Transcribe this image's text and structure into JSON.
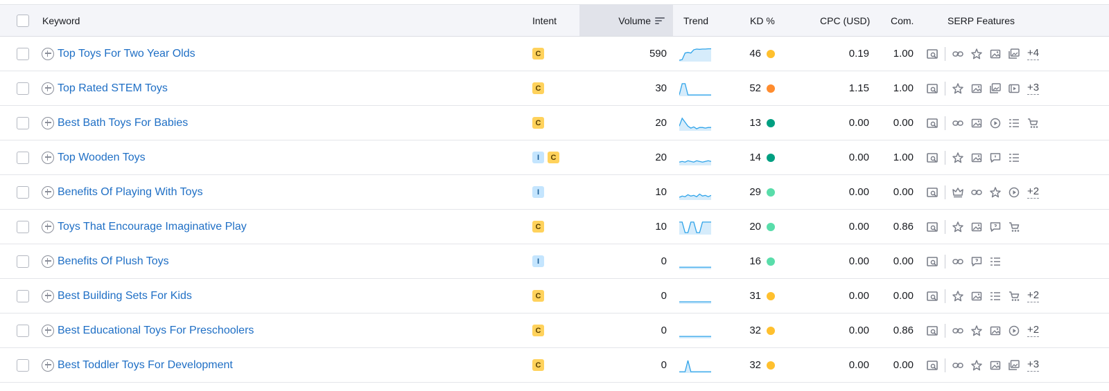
{
  "columns": {
    "keyword": "Keyword",
    "intent": "Intent",
    "volume": "Volume",
    "trend": "Trend",
    "kd": "KD %",
    "cpc": "CPC (USD)",
    "com": "Com.",
    "serp": "SERP Features"
  },
  "colors": {
    "link": "#1f6fc5",
    "kd_yellow": "#ffc02e",
    "kd_orange": "#ff8c2e",
    "kd_dark_green": "#009f81",
    "kd_green": "#59ddaa",
    "trend_line": "#2ea3e9"
  },
  "rows": [
    {
      "keyword": "Top Toys For Two Year Olds",
      "intent": [
        "C"
      ],
      "volume": "590",
      "trend": [
        0.05,
        0.1,
        0.6,
        0.65,
        0.6,
        0.85,
        0.9,
        0.88,
        0.9,
        0.9,
        0.92,
        0.92
      ],
      "kd": "46",
      "kd_color": "#ffc02e",
      "cpc": "0.19",
      "com": "1.00",
      "serp": [
        "link-icon",
        "star-icon",
        "image-icon",
        "images-icon"
      ],
      "more": "+4"
    },
    {
      "keyword": "Top Rated STEM Toys",
      "intent": [
        "C"
      ],
      "volume": "30",
      "trend": [
        0.05,
        0.9,
        0.9,
        0.05,
        0.05,
        0.05,
        0.05,
        0.05,
        0.05,
        0.05,
        0.05,
        0.05
      ],
      "kd": "52",
      "kd_color": "#ff8c2e",
      "cpc": "1.15",
      "com": "1.00",
      "serp": [
        "star-icon",
        "image-icon",
        "images-icon",
        "video-icon"
      ],
      "more": "+3"
    },
    {
      "keyword": "Best Bath Toys For Babies",
      "intent": [
        "C"
      ],
      "volume": "20",
      "trend": [
        0.3,
        0.9,
        0.6,
        0.3,
        0.15,
        0.25,
        0.1,
        0.2,
        0.2,
        0.15,
        0.2,
        0.2
      ],
      "kd": "13",
      "kd_color": "#009f81",
      "cpc": "0.00",
      "com": "0.00",
      "serp": [
        "link-icon",
        "image-icon",
        "play-icon",
        "list-icon",
        "cart-icon"
      ],
      "more": ""
    },
    {
      "keyword": "Top Wooden Toys",
      "intent": [
        "I",
        "C"
      ],
      "volume": "20",
      "trend": [
        0.2,
        0.25,
        0.2,
        0.3,
        0.25,
        0.2,
        0.3,
        0.25,
        0.2,
        0.25,
        0.3,
        0.25
      ],
      "kd": "14",
      "kd_color": "#009f81",
      "cpc": "0.00",
      "com": "1.00",
      "serp": [
        "star-icon",
        "image-icon",
        "chat-icon",
        "list-icon"
      ],
      "more": ""
    },
    {
      "keyword": "Benefits Of Playing With Toys",
      "intent": [
        "I"
      ],
      "volume": "10",
      "trend": [
        0.15,
        0.25,
        0.2,
        0.35,
        0.25,
        0.3,
        0.2,
        0.4,
        0.25,
        0.3,
        0.2,
        0.3
      ],
      "kd": "29",
      "kd_color": "#59ddaa",
      "cpc": "0.00",
      "com": "0.00",
      "serp": [
        "crown-icon",
        "link-icon",
        "star-icon",
        "play-icon"
      ],
      "more": "+2"
    },
    {
      "keyword": "Toys That Encourage Imaginative Play",
      "intent": [
        "C"
      ],
      "volume": "10",
      "trend": [
        0.9,
        0.9,
        0.1,
        0.1,
        0.9,
        0.9,
        0.1,
        0.1,
        0.9,
        0.9,
        0.9,
        0.9
      ],
      "kd": "20",
      "kd_color": "#59ddaa",
      "cpc": "0.00",
      "com": "0.86",
      "serp": [
        "star-icon",
        "image-icon",
        "faq-icon",
        "cart-icon"
      ],
      "more": ""
    },
    {
      "keyword": "Benefits Of Plush Toys",
      "intent": [
        "I"
      ],
      "volume": "0",
      "trend": [
        0.1,
        0.1,
        0.1,
        0.1,
        0.1,
        0.1,
        0.1,
        0.1,
        0.1,
        0.1,
        0.1,
        0.1
      ],
      "kd": "16",
      "kd_color": "#59ddaa",
      "cpc": "0.00",
      "com": "0.00",
      "serp": [
        "link-icon",
        "faq-icon",
        "list-icon"
      ],
      "more": ""
    },
    {
      "keyword": "Best Building Sets For Kids",
      "intent": [
        "C"
      ],
      "volume": "0",
      "trend": [
        0.1,
        0.1,
        0.1,
        0.1,
        0.1,
        0.1,
        0.1,
        0.1,
        0.1,
        0.1,
        0.1,
        0.1
      ],
      "kd": "31",
      "kd_color": "#ffc02e",
      "cpc": "0.00",
      "com": "0.00",
      "serp": [
        "star-icon",
        "image-icon",
        "list-icon",
        "cart-icon"
      ],
      "more": "+2"
    },
    {
      "keyword": "Best Educational Toys For Preschoolers",
      "intent": [
        "C"
      ],
      "volume": "0",
      "trend": [
        0.1,
        0.1,
        0.1,
        0.1,
        0.1,
        0.1,
        0.1,
        0.1,
        0.1,
        0.1,
        0.1,
        0.1
      ],
      "kd": "32",
      "kd_color": "#ffc02e",
      "cpc": "0.00",
      "com": "0.86",
      "serp": [
        "link-icon",
        "star-icon",
        "image-icon",
        "play-icon"
      ],
      "more": "+2"
    },
    {
      "keyword": "Best Toddler Toys For Development",
      "intent": [
        "C"
      ],
      "volume": "0",
      "trend": [
        0.05,
        0.05,
        0.05,
        0.9,
        0.05,
        0.05,
        0.05,
        0.05,
        0.05,
        0.05,
        0.05,
        0.05
      ],
      "kd": "32",
      "kd_color": "#ffc02e",
      "cpc": "0.00",
      "com": "0.00",
      "serp": [
        "link-icon",
        "star-icon",
        "image-icon",
        "images-icon"
      ],
      "more": "+3"
    }
  ]
}
